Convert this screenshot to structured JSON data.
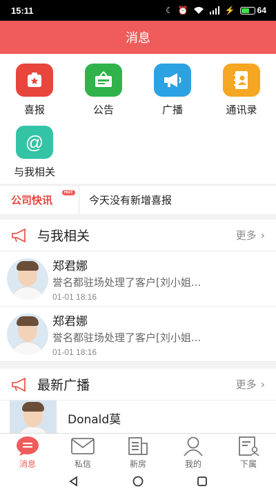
{
  "status": {
    "time": "15:11",
    "battery": "64",
    "battery_level": 0.64,
    "net_speed": "K/s"
  },
  "header": {
    "title": "消息"
  },
  "quick_actions": [
    {
      "label": "喜报",
      "color": "#e8453c",
      "icon": "trophy-icon"
    },
    {
      "label": "公告",
      "color": "#2fb34a",
      "icon": "notice-board-icon"
    },
    {
      "label": "广播",
      "color": "#2da2e2",
      "icon": "megaphone-icon"
    },
    {
      "label": "通讯录",
      "color": "#f5a623",
      "icon": "address-book-icon"
    },
    {
      "label": "与我相关",
      "color": "#33c4a6",
      "icon": "at-sign-icon"
    }
  ],
  "news": {
    "tag": "公司快讯",
    "badge": "HOT",
    "text": "今天没有新增喜报"
  },
  "related": {
    "title": "与我相关",
    "more": "更多",
    "items": [
      {
        "name": "郑君娜",
        "body": "誉名都驻场处理了客户[刘小姐...",
        "time": "01-01 18:16"
      },
      {
        "name": "郑君娜",
        "body": "誉名都驻场处理了客户[刘小姐...",
        "time": "01-01 18:16"
      }
    ]
  },
  "broadcast": {
    "title": "最新广播",
    "more": "更多",
    "items": [
      {
        "name": "Donald莫"
      }
    ]
  },
  "tabs": [
    {
      "label": "消息",
      "active": true
    },
    {
      "label": "私信",
      "active": false
    },
    {
      "label": "新房",
      "active": false
    },
    {
      "label": "我的",
      "active": false
    },
    {
      "label": "下属",
      "active": false
    }
  ],
  "colors": {
    "accent": "#f05b5b",
    "news_tag": "#e8453c"
  }
}
